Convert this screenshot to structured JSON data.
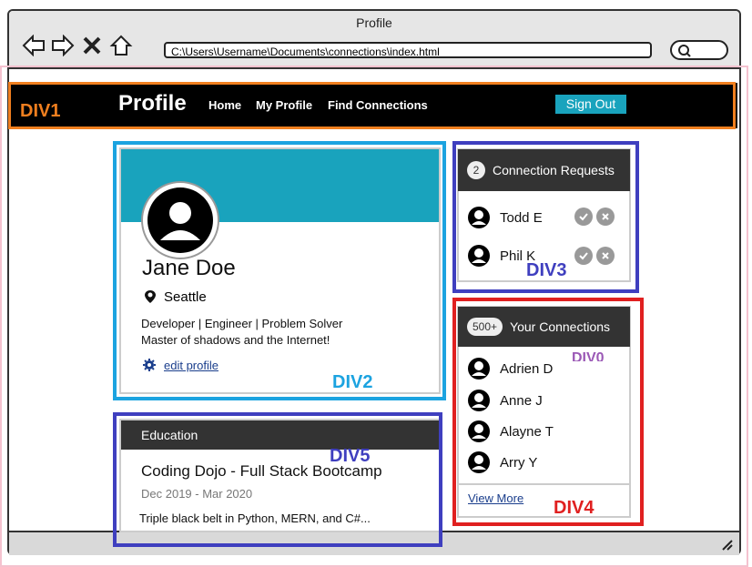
{
  "window": {
    "title": "Profile",
    "url": "C:\\Users\\Username\\Documents\\connections\\index.html"
  },
  "navbar": {
    "brand": "Profile",
    "links": [
      "Home",
      "My Profile",
      "Find Connections"
    ],
    "signout_label": "Sign Out"
  },
  "labels": {
    "div1": "DIV1",
    "div2": "DIV2",
    "div3": "DIV3",
    "div4": "DIV4",
    "div5": "DIV5",
    "div0": "DIV0"
  },
  "profile": {
    "name": "Jane Doe",
    "location": "Seattle",
    "description_line1": "Developer | Engineer | Problem Solver",
    "description_line2": "Master of shadows and the Internet!",
    "edit_label": "edit profile"
  },
  "requests": {
    "count": "2",
    "title": "Connection Requests",
    "people": [
      "Todd E",
      "Phil K"
    ]
  },
  "connections": {
    "count": "500+",
    "title": "Your Connections",
    "people": [
      "Adrien D",
      "Anne J",
      "Alayne T",
      "Arry Y"
    ],
    "view_more": "View More"
  },
  "education": {
    "header": "Education",
    "school": "Coding Dojo - Full Stack Bootcamp",
    "dates": "Dec 2019 - Mar 2020",
    "description": "Triple black belt in Python, MERN, and C#..."
  },
  "colors": {
    "accent": "#19a3bd",
    "div1": "#f07f1f",
    "div2": "#1ca3e0",
    "div3": "#3f3fbf",
    "div4": "#e02020",
    "div5": "#3f3fbf"
  }
}
